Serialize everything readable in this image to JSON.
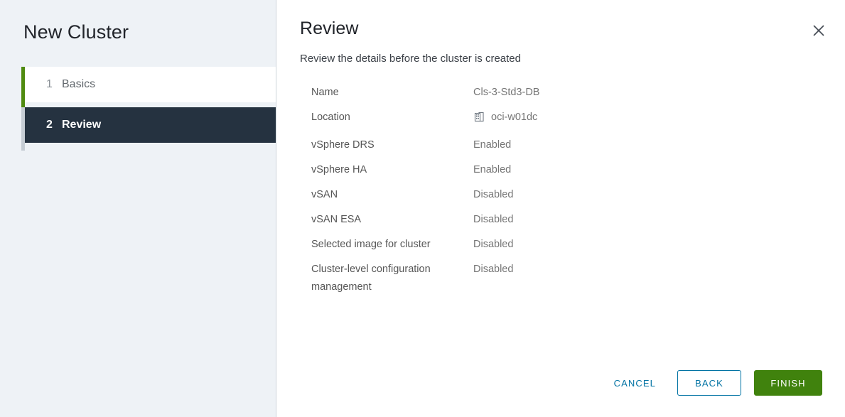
{
  "wizard": {
    "title": "New Cluster"
  },
  "sidebar": {
    "steps": [
      {
        "number": "1",
        "label": "Basics",
        "state": "complete"
      },
      {
        "number": "2",
        "label": "Review",
        "state": "active"
      }
    ]
  },
  "header": {
    "title": "Review",
    "subtitle": "Review the details before the cluster is created",
    "close_icon": "close-icon"
  },
  "details": {
    "rows": [
      {
        "label": "Name",
        "value": "Cls-3-Std3-DB",
        "icon": ""
      },
      {
        "label": "Location",
        "value": "oci-w01dc",
        "icon": "datacenter-icon"
      },
      {
        "label": "vSphere DRS",
        "value": "Enabled",
        "icon": ""
      },
      {
        "label": "vSphere HA",
        "value": "Enabled",
        "icon": ""
      },
      {
        "label": "vSAN",
        "value": "Disabled",
        "icon": ""
      },
      {
        "label": "vSAN ESA",
        "value": "Disabled",
        "icon": ""
      },
      {
        "label": "Selected image for cluster",
        "value": "Disabled",
        "icon": ""
      },
      {
        "label": "Cluster-level configuration management",
        "value": "Disabled",
        "icon": ""
      }
    ]
  },
  "footer": {
    "cancel_label": "CANCEL",
    "back_label": "BACK",
    "finish_label": "FINISH"
  },
  "colors": {
    "sidebar_bg": "#eef2f6",
    "active_step_bg": "#253240",
    "rail_progress": "#4f8a10",
    "rail_track": "#c6cdd4",
    "link_blue": "#0072a3",
    "finish_green": "#40820d",
    "label_gray": "#565656",
    "value_gray": "#757575"
  }
}
